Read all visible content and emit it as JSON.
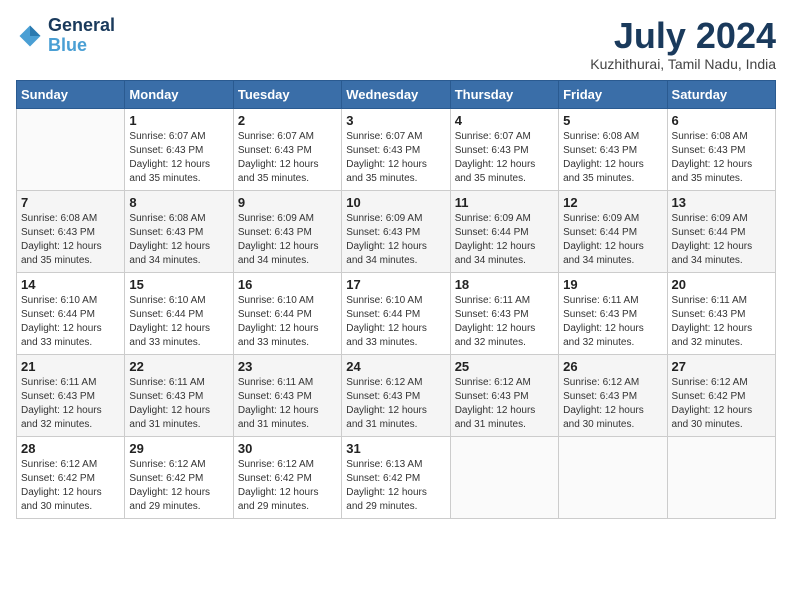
{
  "logo": {
    "line1": "General",
    "line2": "Blue"
  },
  "title": "July 2024",
  "location": "Kuzhithurai, Tamil Nadu, India",
  "days_header": [
    "Sunday",
    "Monday",
    "Tuesday",
    "Wednesday",
    "Thursday",
    "Friday",
    "Saturday"
  ],
  "weeks": [
    [
      {
        "day": "",
        "sunrise": "",
        "sunset": "",
        "daylight": ""
      },
      {
        "day": "1",
        "sunrise": "Sunrise: 6:07 AM",
        "sunset": "Sunset: 6:43 PM",
        "daylight": "Daylight: 12 hours and 35 minutes."
      },
      {
        "day": "2",
        "sunrise": "Sunrise: 6:07 AM",
        "sunset": "Sunset: 6:43 PM",
        "daylight": "Daylight: 12 hours and 35 minutes."
      },
      {
        "day": "3",
        "sunrise": "Sunrise: 6:07 AM",
        "sunset": "Sunset: 6:43 PM",
        "daylight": "Daylight: 12 hours and 35 minutes."
      },
      {
        "day": "4",
        "sunrise": "Sunrise: 6:07 AM",
        "sunset": "Sunset: 6:43 PM",
        "daylight": "Daylight: 12 hours and 35 minutes."
      },
      {
        "day": "5",
        "sunrise": "Sunrise: 6:08 AM",
        "sunset": "Sunset: 6:43 PM",
        "daylight": "Daylight: 12 hours and 35 minutes."
      },
      {
        "day": "6",
        "sunrise": "Sunrise: 6:08 AM",
        "sunset": "Sunset: 6:43 PM",
        "daylight": "Daylight: 12 hours and 35 minutes."
      }
    ],
    [
      {
        "day": "7",
        "sunrise": "Sunrise: 6:08 AM",
        "sunset": "Sunset: 6:43 PM",
        "daylight": "Daylight: 12 hours and 35 minutes."
      },
      {
        "day": "8",
        "sunrise": "Sunrise: 6:08 AM",
        "sunset": "Sunset: 6:43 PM",
        "daylight": "Daylight: 12 hours and 34 minutes."
      },
      {
        "day": "9",
        "sunrise": "Sunrise: 6:09 AM",
        "sunset": "Sunset: 6:43 PM",
        "daylight": "Daylight: 12 hours and 34 minutes."
      },
      {
        "day": "10",
        "sunrise": "Sunrise: 6:09 AM",
        "sunset": "Sunset: 6:43 PM",
        "daylight": "Daylight: 12 hours and 34 minutes."
      },
      {
        "day": "11",
        "sunrise": "Sunrise: 6:09 AM",
        "sunset": "Sunset: 6:44 PM",
        "daylight": "Daylight: 12 hours and 34 minutes."
      },
      {
        "day": "12",
        "sunrise": "Sunrise: 6:09 AM",
        "sunset": "Sunset: 6:44 PM",
        "daylight": "Daylight: 12 hours and 34 minutes."
      },
      {
        "day": "13",
        "sunrise": "Sunrise: 6:09 AM",
        "sunset": "Sunset: 6:44 PM",
        "daylight": "Daylight: 12 hours and 34 minutes."
      }
    ],
    [
      {
        "day": "14",
        "sunrise": "Sunrise: 6:10 AM",
        "sunset": "Sunset: 6:44 PM",
        "daylight": "Daylight: 12 hours and 33 minutes."
      },
      {
        "day": "15",
        "sunrise": "Sunrise: 6:10 AM",
        "sunset": "Sunset: 6:44 PM",
        "daylight": "Daylight: 12 hours and 33 minutes."
      },
      {
        "day": "16",
        "sunrise": "Sunrise: 6:10 AM",
        "sunset": "Sunset: 6:44 PM",
        "daylight": "Daylight: 12 hours and 33 minutes."
      },
      {
        "day": "17",
        "sunrise": "Sunrise: 6:10 AM",
        "sunset": "Sunset: 6:44 PM",
        "daylight": "Daylight: 12 hours and 33 minutes."
      },
      {
        "day": "18",
        "sunrise": "Sunrise: 6:11 AM",
        "sunset": "Sunset: 6:43 PM",
        "daylight": "Daylight: 12 hours and 32 minutes."
      },
      {
        "day": "19",
        "sunrise": "Sunrise: 6:11 AM",
        "sunset": "Sunset: 6:43 PM",
        "daylight": "Daylight: 12 hours and 32 minutes."
      },
      {
        "day": "20",
        "sunrise": "Sunrise: 6:11 AM",
        "sunset": "Sunset: 6:43 PM",
        "daylight": "Daylight: 12 hours and 32 minutes."
      }
    ],
    [
      {
        "day": "21",
        "sunrise": "Sunrise: 6:11 AM",
        "sunset": "Sunset: 6:43 PM",
        "daylight": "Daylight: 12 hours and 32 minutes."
      },
      {
        "day": "22",
        "sunrise": "Sunrise: 6:11 AM",
        "sunset": "Sunset: 6:43 PM",
        "daylight": "Daylight: 12 hours and 31 minutes."
      },
      {
        "day": "23",
        "sunrise": "Sunrise: 6:11 AM",
        "sunset": "Sunset: 6:43 PM",
        "daylight": "Daylight: 12 hours and 31 minutes."
      },
      {
        "day": "24",
        "sunrise": "Sunrise: 6:12 AM",
        "sunset": "Sunset: 6:43 PM",
        "daylight": "Daylight: 12 hours and 31 minutes."
      },
      {
        "day": "25",
        "sunrise": "Sunrise: 6:12 AM",
        "sunset": "Sunset: 6:43 PM",
        "daylight": "Daylight: 12 hours and 31 minutes."
      },
      {
        "day": "26",
        "sunrise": "Sunrise: 6:12 AM",
        "sunset": "Sunset: 6:43 PM",
        "daylight": "Daylight: 12 hours and 30 minutes."
      },
      {
        "day": "27",
        "sunrise": "Sunrise: 6:12 AM",
        "sunset": "Sunset: 6:42 PM",
        "daylight": "Daylight: 12 hours and 30 minutes."
      }
    ],
    [
      {
        "day": "28",
        "sunrise": "Sunrise: 6:12 AM",
        "sunset": "Sunset: 6:42 PM",
        "daylight": "Daylight: 12 hours and 30 minutes."
      },
      {
        "day": "29",
        "sunrise": "Sunrise: 6:12 AM",
        "sunset": "Sunset: 6:42 PM",
        "daylight": "Daylight: 12 hours and 29 minutes."
      },
      {
        "day": "30",
        "sunrise": "Sunrise: 6:12 AM",
        "sunset": "Sunset: 6:42 PM",
        "daylight": "Daylight: 12 hours and 29 minutes."
      },
      {
        "day": "31",
        "sunrise": "Sunrise: 6:13 AM",
        "sunset": "Sunset: 6:42 PM",
        "daylight": "Daylight: 12 hours and 29 minutes."
      },
      {
        "day": "",
        "sunrise": "",
        "sunset": "",
        "daylight": ""
      },
      {
        "day": "",
        "sunrise": "",
        "sunset": "",
        "daylight": ""
      },
      {
        "day": "",
        "sunrise": "",
        "sunset": "",
        "daylight": ""
      }
    ]
  ]
}
